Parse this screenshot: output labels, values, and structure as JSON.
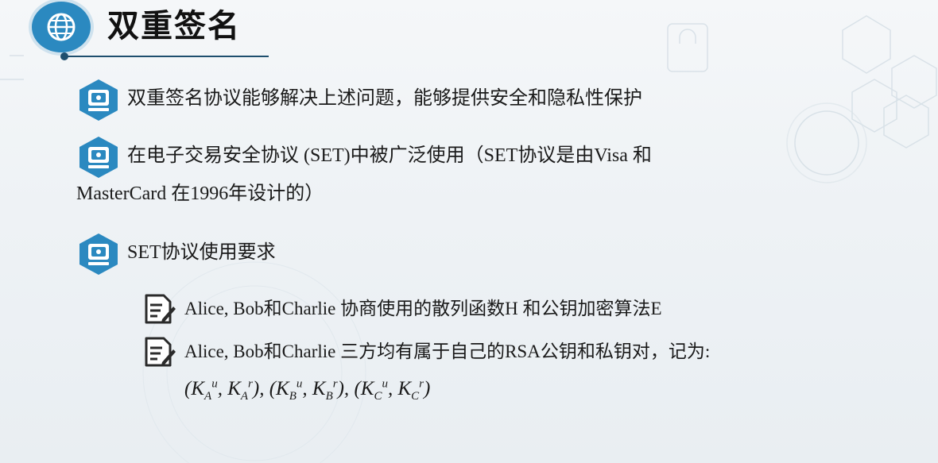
{
  "title": "双重签名",
  "bullets": [
    {
      "lines": [
        "双重签名协议能够解决上述问题，能够提供安全和隐私性保护"
      ]
    },
    {
      "lines": [
        "在电子交易安全协议 (SET)中被广泛使用（SET协议是由Visa 和",
        "MasterCard 在1996年设计的）"
      ]
    },
    {
      "lines": [
        "SET协议使用要求"
      ]
    }
  ],
  "sub_items": [
    "Alice, Bob和Charlie 协商使用的散列函数H 和公钥加密算法E",
    "Alice, Bob和Charlie 三方均有属于自己的RSA公钥和私钥对，记为:"
  ],
  "key_pairs": [
    {
      "open": "(",
      "k1": "K",
      "k1_sub": "A",
      "k1_sup": "u",
      "sep": ", ",
      "k2": "K",
      "k2_sub": "A",
      "k2_sup": "r",
      "close": "), "
    },
    {
      "open": "(",
      "k1": "K",
      "k1_sub": "B",
      "k1_sup": "u",
      "sep": ", ",
      "k2": "K",
      "k2_sub": "B",
      "k2_sup": "r",
      "close": "), "
    },
    {
      "open": "(",
      "k1": "K",
      "k1_sub": "C",
      "k1_sup": "u",
      "sep": ", ",
      "k2": "K",
      "k2_sub": "C",
      "k2_sup": "r",
      "close": ")"
    }
  ],
  "icons": {
    "title": "globe-icon",
    "bullet": "computer-chip-icon",
    "sub": "document-pen-icon"
  },
  "colors": {
    "accent": "#2b89c0",
    "title_underline": "#1e4f6e",
    "text": "#1a1a1a"
  }
}
